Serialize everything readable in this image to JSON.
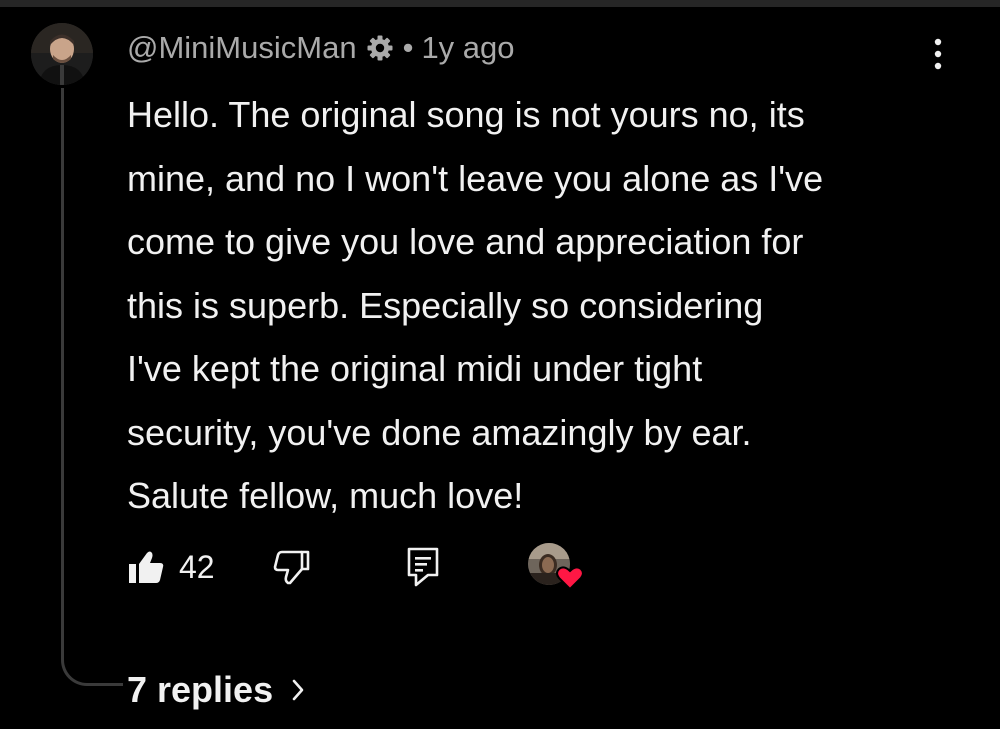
{
  "comment": {
    "author": "@MiniMusicMan",
    "separator": "•",
    "time_ago": "1y ago",
    "text_lines": [
      "Hello. The original song is not yours no, its",
      "mine, and no I won't leave you alone as I've",
      "come to give you love and appreciation for",
      "this is superb. Especially so considering",
      "I've kept the original midi under tight",
      "security, you've done amazingly by ear.",
      "Salute fellow, much love!"
    ],
    "like_count": "42",
    "replies_label": "7 replies",
    "icons": {
      "verified": "gear-badge-icon",
      "menu": "more-vert-icon",
      "like": "thumbs-up-filled-icon",
      "dislike": "thumbs-down-outline-icon",
      "reply": "reply-comment-icon",
      "hearted": "creator-heart-icon",
      "replies_chevron": "chevron-right-icon"
    },
    "colors": {
      "background": "#000000",
      "text": "#f1f1f1",
      "meta": "#aaaaaa",
      "heart": "#ff1744"
    }
  }
}
